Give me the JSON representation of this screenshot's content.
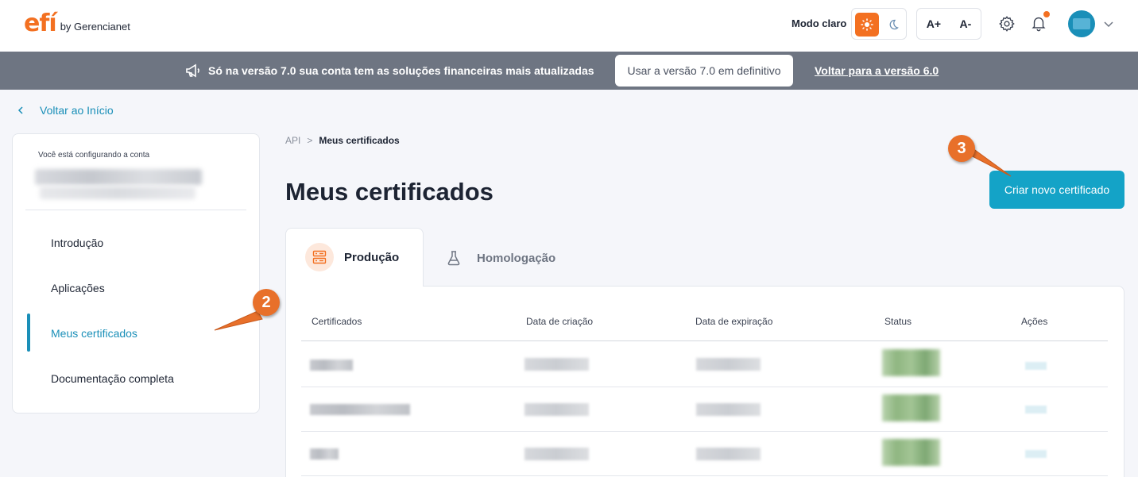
{
  "header": {
    "logo_mark": "efí",
    "logo_sub": "by Gerencianet",
    "mode_label": "Modo claro",
    "font_increase": "A+",
    "font_decrease": "A-"
  },
  "banner": {
    "text": "Só na versão 7.0 sua conta tem as soluções financeiras mais atualizadas",
    "button_label": "Usar a versão 7.0 em definitivo",
    "link_label": "Voltar para a versão 6.0"
  },
  "back_link": "Voltar ao Início",
  "sidebar": {
    "caption": "Você está configurando a conta",
    "items": [
      {
        "label": "Introdução"
      },
      {
        "label": "Aplicações"
      },
      {
        "label": "Meus certificados"
      },
      {
        "label": "Documentação completa"
      }
    ]
  },
  "breadcrumb": {
    "root": "API",
    "separator": ">",
    "current": "Meus certificados"
  },
  "page_title": "Meus certificados",
  "create_button": "Criar novo certificado",
  "tabs": [
    {
      "label": "Produção",
      "active": true
    },
    {
      "label": "Homologação",
      "active": false
    }
  ],
  "table": {
    "columns": [
      "Certificados",
      "Data de criação",
      "Data de expiração",
      "Status",
      "Ações"
    ]
  },
  "annotations": {
    "step2": "2",
    "step3": "3"
  },
  "colors": {
    "brand_orange": "#f37021",
    "accent_blue": "#1a8fb8",
    "button_blue": "#14a3c7",
    "banner_gray": "#6e7582"
  }
}
